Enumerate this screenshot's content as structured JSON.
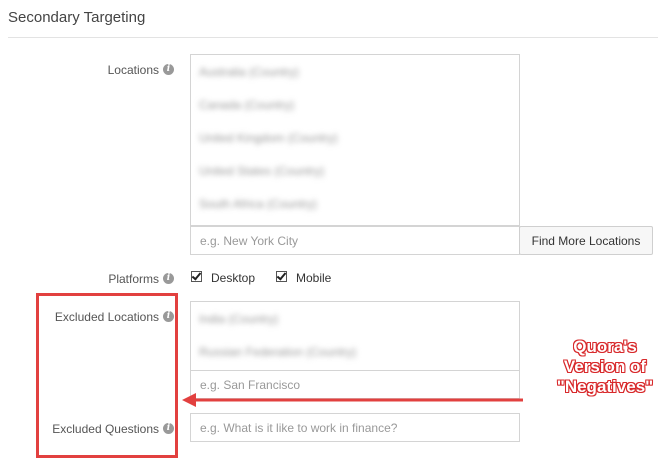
{
  "section": {
    "title": "Secondary Targeting"
  },
  "locations": {
    "label": "Locations",
    "items": [
      "Australia (Country)",
      "Canada (Country)",
      "United Kingdom (Country)",
      "United States (Country)",
      "South Africa (Country)"
    ],
    "placeholder": "e.g. New York City",
    "find_more_label": "Find More Locations"
  },
  "platforms": {
    "label": "Platforms",
    "options": [
      {
        "label": "Desktop",
        "checked": true
      },
      {
        "label": "Mobile",
        "checked": true
      }
    ]
  },
  "excluded_locations": {
    "label": "Excluded Locations",
    "items": [
      "India (Country)",
      "Russian Federation (Country)"
    ],
    "placeholder": "e.g. San Francisco"
  },
  "excluded_questions": {
    "label": "Excluded Questions",
    "placeholder": "e.g. What is it like to work in finance?"
  },
  "annotation": {
    "lines": [
      "Quora's",
      "Version of",
      "\"Negatives\""
    ],
    "color": "#e2403f"
  }
}
